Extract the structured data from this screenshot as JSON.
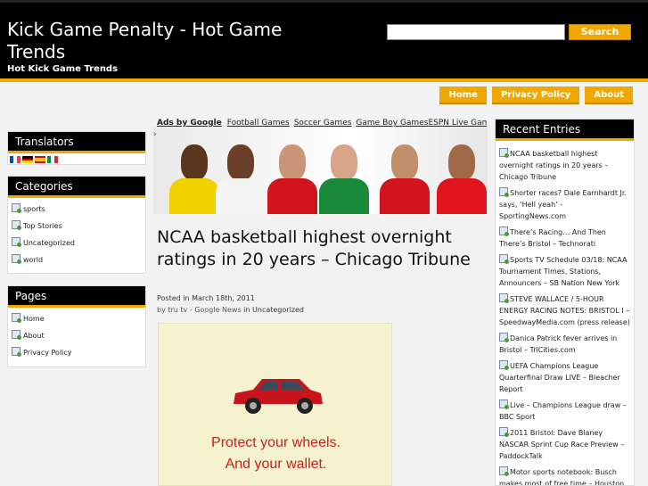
{
  "header": {
    "title": "Kick Game Penalty - Hot Game Trends",
    "tagline": "Hot Kick Game Trends",
    "search_button": "Search"
  },
  "nav": [
    "Home",
    "Privacy Policy",
    "About"
  ],
  "translators": {
    "title": "Translators"
  },
  "categories": {
    "title": "Categories",
    "items": [
      "sports",
      "Top Stories",
      "Uncategorized",
      "world"
    ]
  },
  "pages": {
    "title": "Pages",
    "items": [
      "Home",
      "About",
      "Privacy Policy"
    ]
  },
  "ads": {
    "lead": "Ads by Google",
    "links": [
      "Football Games",
      "Soccer Games",
      "Game Boy Games",
      "ESPN Live Game"
    ]
  },
  "post": {
    "title": "NCAA basketball highest overnight ratings in 20 years – Chicago Tribune",
    "posted": "Posted in March 18th, 2011",
    "by": "by",
    "author": "tru tv - Google News",
    "in": "in",
    "category": "Uncategorized",
    "ad_line1": "Protect your wheels.",
    "ad_line2": "And your wallet."
  },
  "recent": {
    "title": "Recent Entries",
    "items": [
      "NCAA basketball highest overnight ratings in 20 years – Chicago Tribune",
      "Shorter races? Dale Earnhardt Jr. says, ‘Hell yeah’ - SportingNews.com",
      "There’s Racing… And Then There’s Bristol – Technorati",
      "Sports TV Schedule 03/18: NCAA Tournament Times, Stations, Announcers – SB Nation New York",
      "STEVE WALLACE / 5-HOUR ENERGY RACING NOTES: BRISTOL I – SpeedwayMedia.com (press release)",
      "Danica Patrick fever arrives in Bristol – TriCities.com",
      "UEFA Champions League Quarterfinal Draw LIVE – Bleacher Report",
      "Live – Champions League draw – BBC Sport",
      "2011 Bristol: Dave Blaney NASCAR Sprint Cup Race Preview – PaddockTalk",
      "Motor sports notebook: Busch makes most of free time – Houston"
    ]
  },
  "colors": {
    "accent": "#f0a800",
    "header_bg": "#000000",
    "ad_text": "#c8201c"
  }
}
